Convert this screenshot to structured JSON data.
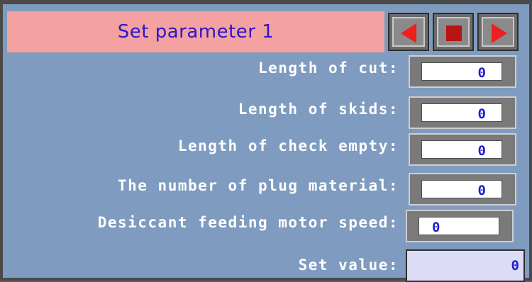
{
  "header": {
    "title": "Set parameter 1"
  },
  "nav": {
    "prev_icon": "arrow-left-icon",
    "stop_icon": "stop-icon",
    "next_icon": "arrow-right-icon"
  },
  "params": [
    {
      "label": "Length of cut:",
      "value": "0"
    },
    {
      "label": "Length of skids:",
      "value": "0"
    },
    {
      "label": "Length of check empty:",
      "value": "0"
    },
    {
      "label": "The number of plug material:",
      "value": "0"
    },
    {
      "label": "Desiccant feeding motor speed:",
      "value": "0"
    }
  ],
  "set_value": {
    "label": "Set value:",
    "value": "0"
  },
  "colors": {
    "header_bg": "#f4a1a1",
    "screen_bg": "#7f9bbf",
    "title_text": "#2a17c9",
    "value_text": "#1c1cd6",
    "arrow": "#ee1f1f"
  }
}
